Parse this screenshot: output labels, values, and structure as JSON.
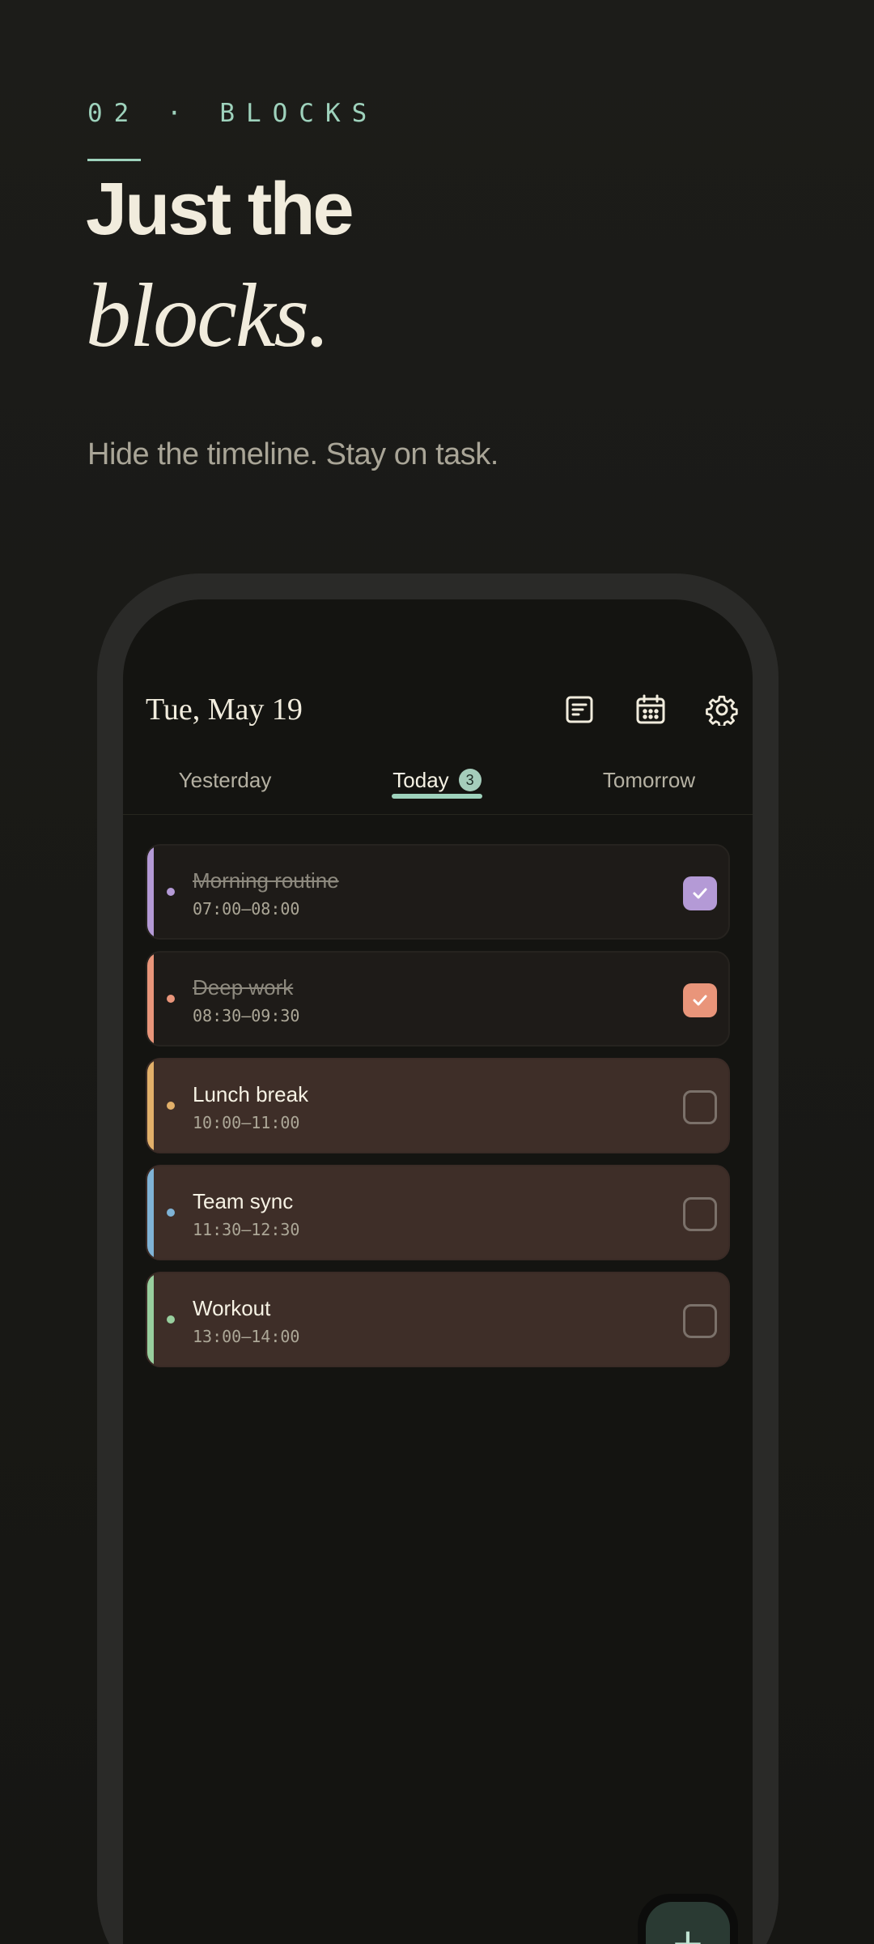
{
  "intro": {
    "eyebrow": "02 · BLOCKS",
    "headline_line1": "Just the",
    "headline_line2": "blocks.",
    "subtitle": "Hide the timeline. Stay on task."
  },
  "app": {
    "date": "Tue, May 19",
    "icons": [
      "notes-icon",
      "calendar-icon",
      "gear-icon"
    ],
    "tabs": [
      {
        "label": "Yesterday",
        "active": false
      },
      {
        "label": "Today",
        "active": true,
        "badge": "3"
      },
      {
        "label": "Tomorrow",
        "active": false
      }
    ],
    "tasks": [
      {
        "title": "Morning routine",
        "time": "07:00–08:00",
        "done": true,
        "color": "#b49ad6"
      },
      {
        "title": "Deep work",
        "time": "08:30–09:30",
        "done": true,
        "color": "#e9957a"
      },
      {
        "title": "Lunch break",
        "time": "10:00–11:00",
        "done": false,
        "color": "#e2b06a"
      },
      {
        "title": "Team sync",
        "time": "11:30–12:30",
        "done": false,
        "color": "#7fb3d6"
      },
      {
        "title": "Workout",
        "time": "13:00–14:00",
        "done": false,
        "color": "#98cf9e"
      }
    ],
    "fab_label": "+"
  },
  "colors": {
    "accent": "#9ed2bc",
    "background": "#1b1b18",
    "text": "#f1ecdd"
  }
}
